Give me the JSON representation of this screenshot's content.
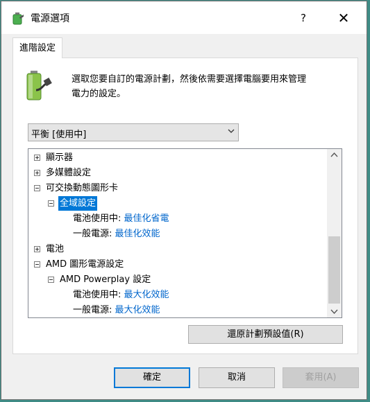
{
  "window": {
    "title": "電源選項",
    "help_label": "?",
    "close_label": "✕"
  },
  "tab": {
    "label": "進階設定"
  },
  "description": {
    "line1": "選取您要自訂的電源計劃，然後依需要選擇電腦要用來管理",
    "line2": "電力的設定。"
  },
  "plan": {
    "selected": "平衡 [使用中]"
  },
  "tree": {
    "display": "顯示器",
    "multimedia": "多媒體設定",
    "switchable": "可交換動態圖形卡",
    "global": "全域設定",
    "battery_setting": {
      "label": "電池使用中: ",
      "value": "最佳化省電"
    },
    "plugged_setting": {
      "label": "一般電源: ",
      "value": "最佳化效能"
    },
    "battery": "電池",
    "amd_graphics": "AMD 圖形電源設定",
    "amd_powerplay": "AMD Powerplay 設定",
    "amd_battery": {
      "label": "電池使用中: ",
      "value": "最大化效能"
    },
    "amd_plugged": {
      "label": "一般電源: ",
      "value": "最大化效能"
    }
  },
  "buttons": {
    "restore": "還原計劃預設值(R)",
    "ok": "確定",
    "cancel": "取消",
    "apply": "套用(A)"
  },
  "colors": {
    "accent": "#0078d7",
    "link_value": "#0066cc",
    "desktop_bg": "#3f8c86"
  }
}
